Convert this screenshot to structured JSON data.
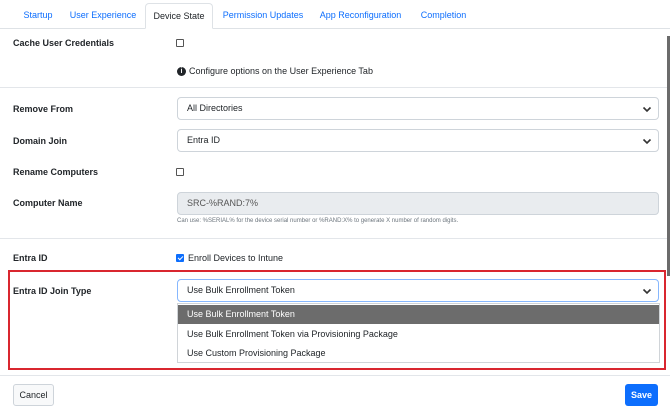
{
  "tabs": [
    {
      "label": "Startup",
      "active": false
    },
    {
      "label": "User Experience",
      "active": false
    },
    {
      "label": "Device State",
      "active": true
    },
    {
      "label": "Permission Updates",
      "active": false
    },
    {
      "label": "App Reconfiguration",
      "active": false
    },
    {
      "label": "Completion",
      "active": false
    }
  ],
  "form": {
    "cache_user_credentials": {
      "label": "Cache User Credentials",
      "checked": false
    },
    "info_text": "Configure options on the User Experience Tab",
    "remove_from": {
      "label": "Remove From",
      "value": "All Directories"
    },
    "domain_join": {
      "label": "Domain Join",
      "value": "Entra ID"
    },
    "rename_computers": {
      "label": "Rename Computers",
      "checked": false
    },
    "computer_name": {
      "label": "Computer Name",
      "value": "SRC-%RAND:7%",
      "help": "Can use: %SERIAL% for the device serial number or %RAND:X% to generate X number of random digits."
    },
    "entra_id": {
      "label": "Entra ID",
      "checkbox_label": "Enroll Devices to Intune",
      "checked": true
    },
    "entra_join_type": {
      "label": "Entra ID Join Type",
      "value": "Use Bulk Enrollment Token",
      "options": [
        "Use Bulk Enrollment Token",
        "Use Bulk Enrollment Token via Provisioning Package",
        "Use Custom Provisioning Package"
      ],
      "selected_index": 0
    }
  },
  "footer": {
    "cancel_label": "Cancel",
    "save_label": "Save"
  },
  "colors": {
    "accent": "#0d6efd",
    "highlight_border": "#d9262f",
    "dropdown_selected": "#6c6c6c"
  }
}
